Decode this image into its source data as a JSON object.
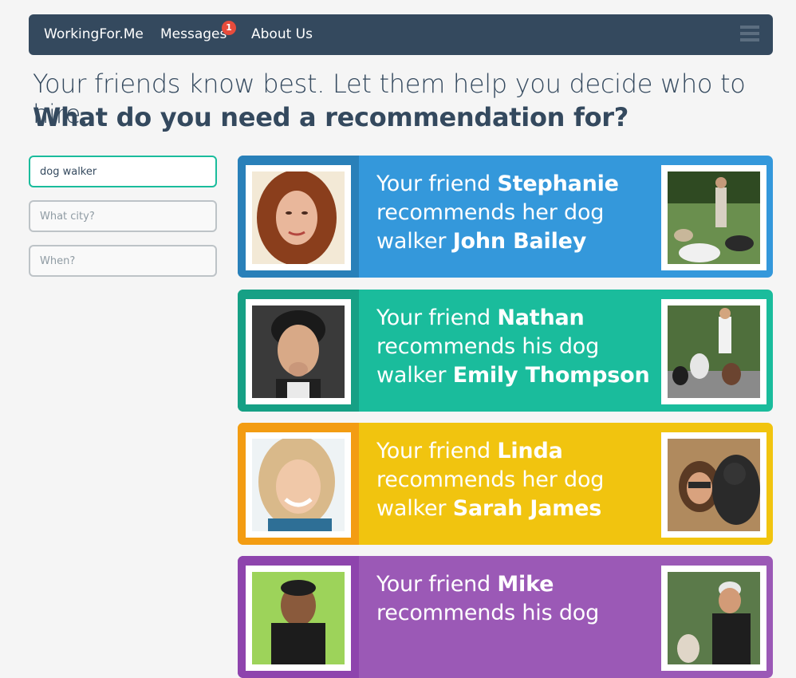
{
  "nav": {
    "brand": "WorkingFor.Me",
    "messages": "Messages",
    "messages_badge": "1",
    "about": "About Us"
  },
  "headline": "Your friends know best. Let them help you decide who to hire.",
  "subheadline": "What do you need a recommendation for?",
  "search": {
    "service_value": "dog walker",
    "city_placeholder": "What city?",
    "when_placeholder": "When?"
  },
  "colors": {
    "navbar": "#34495e",
    "blue": "#3498db",
    "blue_dark": "#2980b9",
    "green": "#1abc9c",
    "green_dark": "#16a085",
    "yellow": "#f1c40f",
    "yellow_dark": "#f39c12",
    "purple": "#9b59b6",
    "purple_dark": "#8e44ad"
  },
  "cards": [
    {
      "prefix": "Your friend ",
      "friend": "Stephanie",
      "middle": " recommends her dog walker ",
      "walker": "John Bailey"
    },
    {
      "prefix": "Your friend ",
      "friend": "Nathan",
      "middle": " recommends his dog walker ",
      "walker": "Emily Thompson"
    },
    {
      "prefix": "Your friend ",
      "friend": "Linda",
      "middle": " recommends her dog walker ",
      "walker": "Sarah James"
    },
    {
      "prefix": "Your friend ",
      "friend": "Mike",
      "middle": " recommends his dog",
      "walker": ""
    }
  ]
}
